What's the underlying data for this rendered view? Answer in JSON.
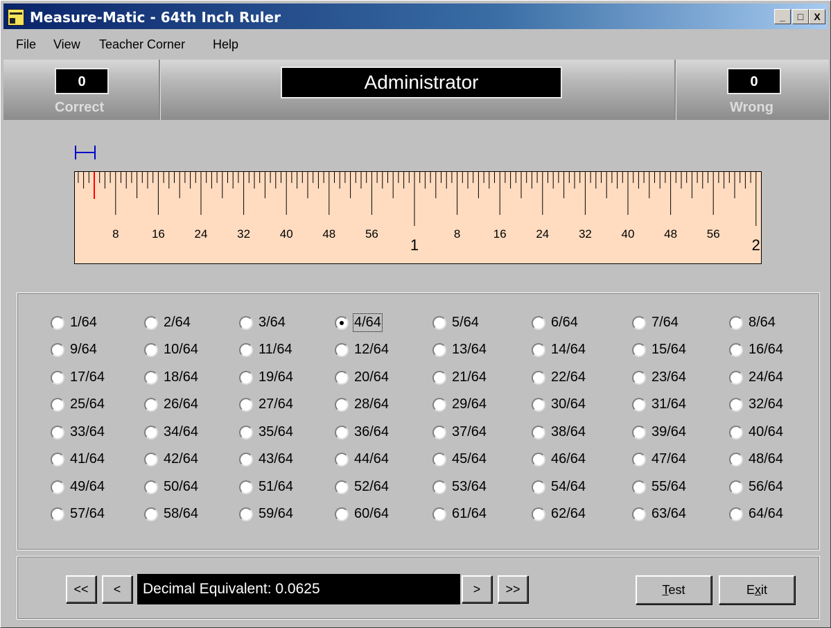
{
  "window": {
    "title": "Measure-Matic - 64th Inch Ruler",
    "controls": [
      "_",
      "□",
      "X"
    ]
  },
  "menu": [
    "File",
    "View",
    "Teacher Corner",
    "Help"
  ],
  "score": {
    "correct_value": "0",
    "correct_label": "Correct",
    "wrong_value": "0",
    "wrong_label": "Wrong",
    "user": "Administrator"
  },
  "ruler": {
    "units": "64th inch",
    "inches": 2,
    "marked_position_64ths": 4,
    "tick_labels": [
      "8",
      "16",
      "24",
      "32",
      "40",
      "48",
      "56",
      "1",
      "8",
      "16",
      "24",
      "32",
      "40",
      "48",
      "56",
      "2"
    ],
    "colors": {
      "face": "#ffdcc0",
      "marker": "#ff0000",
      "bracket": "#0000cc"
    }
  },
  "options": {
    "selected": "4/64",
    "items": [
      "1/64",
      "2/64",
      "3/64",
      "4/64",
      "5/64",
      "6/64",
      "7/64",
      "8/64",
      "9/64",
      "10/64",
      "11/64",
      "12/64",
      "13/64",
      "14/64",
      "15/64",
      "16/64",
      "17/64",
      "18/64",
      "19/64",
      "20/64",
      "21/64",
      "22/64",
      "23/64",
      "24/64",
      "25/64",
      "26/64",
      "27/64",
      "28/64",
      "29/64",
      "30/64",
      "31/64",
      "32/64",
      "33/64",
      "34/64",
      "35/64",
      "36/64",
      "37/64",
      "38/64",
      "39/64",
      "40/64",
      "41/64",
      "42/64",
      "43/64",
      "44/64",
      "45/64",
      "46/64",
      "47/64",
      "48/64",
      "49/64",
      "50/64",
      "51/64",
      "52/64",
      "53/64",
      "54/64",
      "55/64",
      "56/64",
      "57/64",
      "58/64",
      "59/64",
      "60/64",
      "61/64",
      "62/64",
      "63/64",
      "64/64"
    ]
  },
  "nav": {
    "first": "<<",
    "prev": "<",
    "next": ">",
    "last": ">>",
    "decimal_text": "Decimal Equivalent: 0.0625"
  },
  "buttons": {
    "test_prefix": "",
    "test_accel": "T",
    "test_rest": "est",
    "exit_prefix": "E",
    "exit_accel": "x",
    "exit_rest": "it"
  }
}
